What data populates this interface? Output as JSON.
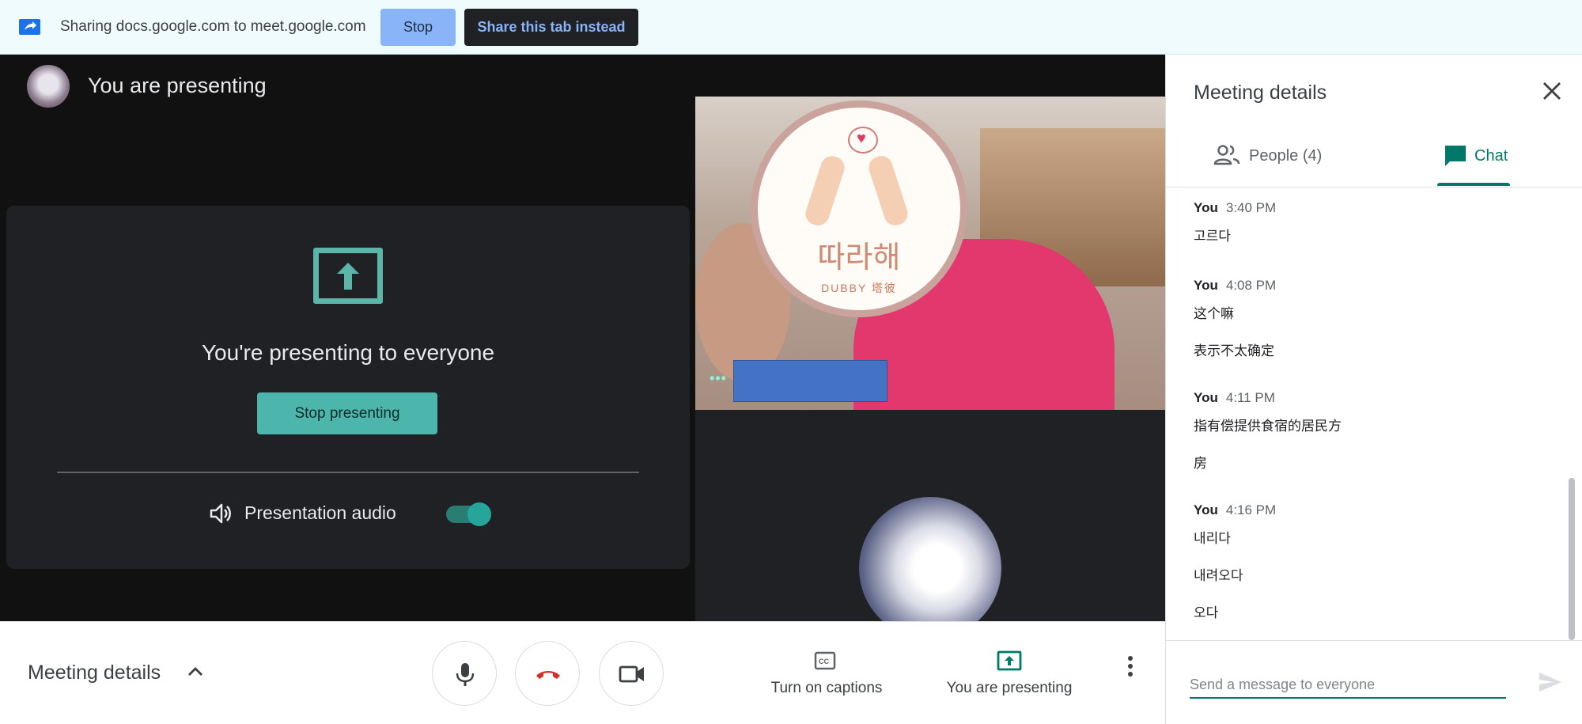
{
  "sharebar": {
    "text": "Sharing docs.google.com to meet.google.com",
    "stop_label": "Stop",
    "share_tab_label": "Share this tab instead"
  },
  "stage": {
    "title": "You are presenting",
    "card": {
      "heading": "You're presenting to everyone",
      "stop_presenting_label": "Stop presenting",
      "audio_label": "Presentation audio",
      "audio_on": true
    },
    "sticker": {
      "korean": "따라해",
      "latin": "DUBBY 塔彼"
    }
  },
  "controls": {
    "details_label": "Meeting details",
    "captions_label": "Turn on captions",
    "presenting_label": "You are presenting"
  },
  "panel": {
    "title": "Meeting details",
    "tabs": [
      {
        "label": "People (4)",
        "active": false
      },
      {
        "label": "Chat",
        "active": true
      }
    ],
    "messages": [
      {
        "sender": "You",
        "time": "3:40 PM",
        "lines": [
          "고르다"
        ]
      },
      {
        "sender": "You",
        "time": "4:08 PM",
        "lines": [
          "这个嘛",
          "表示不太确定"
        ]
      },
      {
        "sender": "You",
        "time": "4:11 PM",
        "lines": [
          "指有偿提供食宿的居民方",
          "房"
        ]
      },
      {
        "sender": "You",
        "time": "4:16 PM",
        "lines": [
          "내리다",
          "내려오다",
          "오다"
        ]
      }
    ],
    "input_placeholder": "Send a message to everyone"
  },
  "colors": {
    "accent": "#00796b",
    "teal_button": "#4db6ac",
    "stage_bg": "#111111",
    "card_bg": "#202124",
    "sharebar_bg": "#f0fbfd",
    "hangup_red": "#d93025"
  }
}
